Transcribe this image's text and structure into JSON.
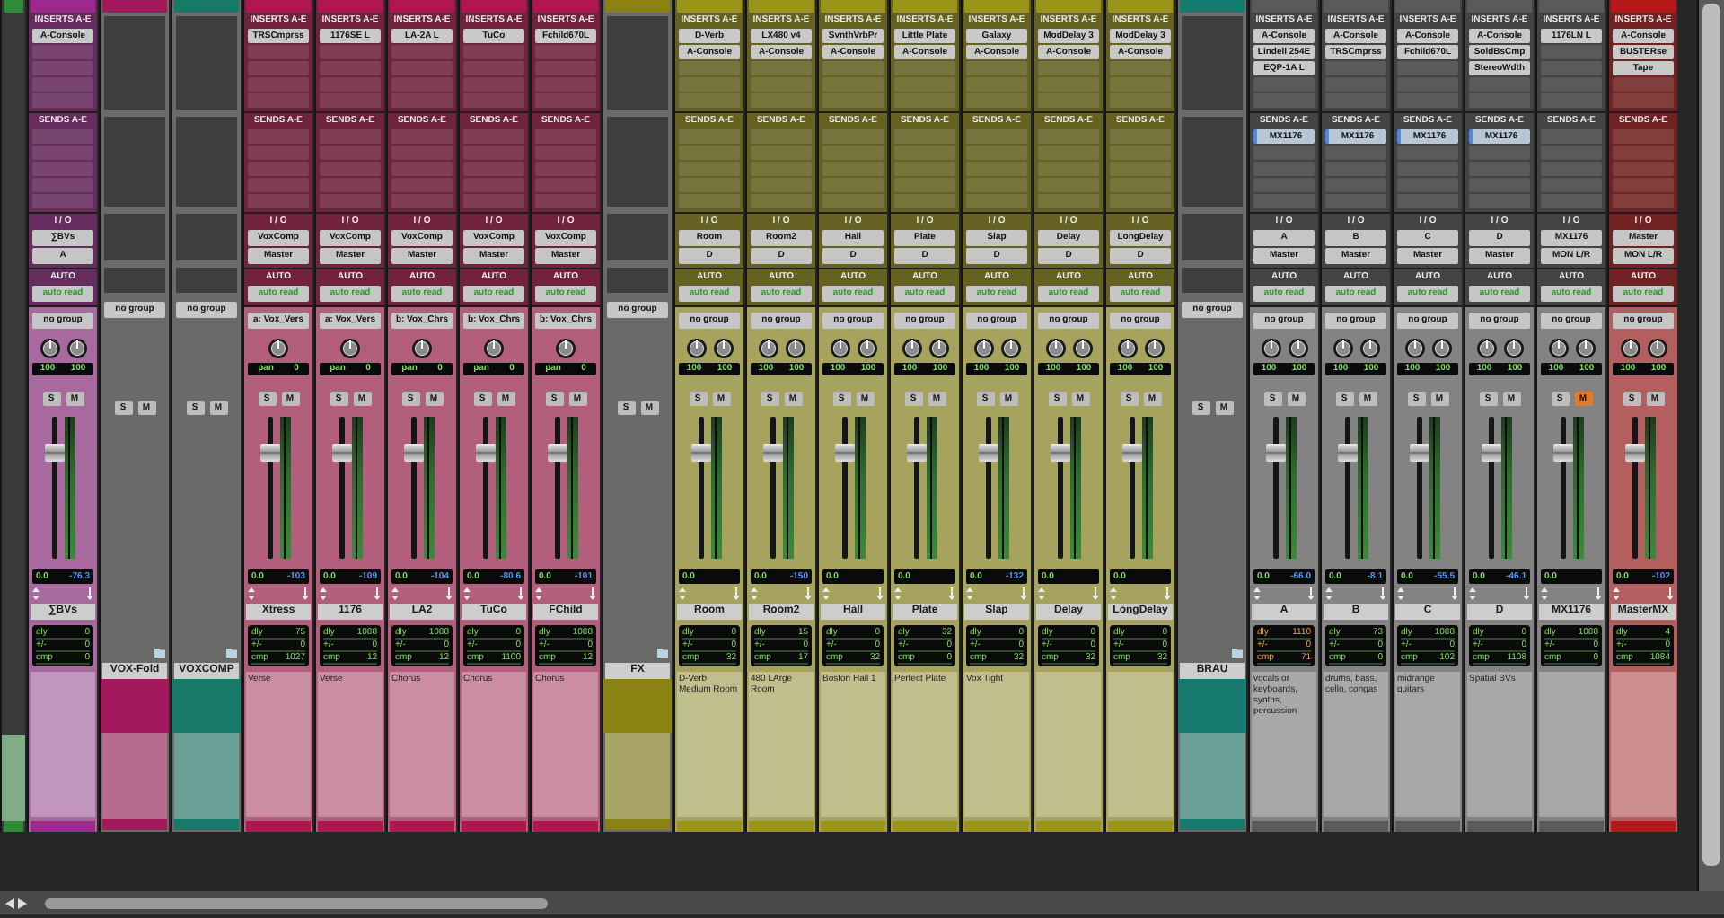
{
  "channels": [
    {
      "kind": "partial",
      "color": "#2f8a3a"
    },
    {
      "kind": "audio",
      "name": "∑BVs",
      "color": "#9c2a8c",
      "inserts_label": "INSERTS A-E",
      "inserts": [
        "A-Console"
      ],
      "sends_label": "SENDS A-E",
      "io_label": "I / O",
      "input": "∑BVs",
      "output": "A",
      "auto_label": "AUTO",
      "automation": "auto read",
      "group": "no group",
      "knobs": [
        "100",
        "100"
      ],
      "solo": {
        "label": "S",
        "on": false
      },
      "mute": {
        "label": "M",
        "on": false
      },
      "fader": {
        "level": 0.75
      },
      "volume": "0.0",
      "peak": "-76.3",
      "delay": [
        {
          "label": "dly",
          "value": "0"
        },
        {
          "label": "+/-",
          "value": "0"
        },
        {
          "label": "cmp",
          "value": "0"
        }
      ],
      "delay_warning": false
    },
    {
      "kind": "folder",
      "name": "VOX-Fold",
      "color": "#a3195b",
      "group": "no group",
      "solo": {
        "label": "S",
        "on": false
      },
      "mute": {
        "label": "M",
        "on": false
      }
    },
    {
      "kind": "folder",
      "name": "VOXCOMP",
      "color": "#177a68",
      "group": "no group",
      "solo": {
        "label": "S",
        "on": false
      },
      "mute": {
        "label": "M",
        "on": false
      }
    },
    {
      "kind": "aux",
      "name": "Xtress",
      "color": "#b0174f",
      "inserts_label": "INSERTS A-E",
      "inserts": [
        "TRSCmprss"
      ],
      "sends_label": "SENDS A-E",
      "io_label": "I / O",
      "input": "VoxComp",
      "output": "Master",
      "auto_label": "AUTO",
      "automation": "auto read",
      "group": "a: Vox_Vers",
      "pan": {
        "label": "pan",
        "value": "0"
      },
      "solo": {
        "label": "S",
        "on": false
      },
      "mute": {
        "label": "M",
        "on": false
      },
      "fader": {
        "level": 0.75
      },
      "volume": "0.0",
      "peak": "-103",
      "delay": [
        {
          "label": "dly",
          "value": "75"
        },
        {
          "label": "+/-",
          "value": "0"
        },
        {
          "label": "cmp",
          "value": "1027"
        }
      ],
      "delay_warning": false,
      "comment": "Verse"
    },
    {
      "kind": "aux",
      "name": "1176",
      "color": "#b0174f",
      "inserts_label": "INSERTS A-E",
      "inserts": [
        "1176SE L"
      ],
      "sends_label": "SENDS A-E",
      "io_label": "I / O",
      "input": "VoxComp",
      "output": "Master",
      "auto_label": "AUTO",
      "automation": "auto read",
      "group": "a: Vox_Vers",
      "pan": {
        "label": "pan",
        "value": "0"
      },
      "solo": {
        "label": "S",
        "on": false
      },
      "mute": {
        "label": "M",
        "on": false
      },
      "fader": {
        "level": 0.75
      },
      "volume": "0.0",
      "peak": "-109",
      "delay": [
        {
          "label": "dly",
          "value": "1088"
        },
        {
          "label": "+/-",
          "value": "0"
        },
        {
          "label": "cmp",
          "value": "12"
        }
      ],
      "delay_warning": false,
      "comment": "Verse"
    },
    {
      "kind": "aux",
      "name": "LA2",
      "color": "#b0174f",
      "inserts_label": "INSERTS A-E",
      "inserts": [
        "LA-2A L"
      ],
      "sends_label": "SENDS A-E",
      "io_label": "I / O",
      "input": "VoxComp",
      "output": "Master",
      "auto_label": "AUTO",
      "automation": "auto read",
      "group": "b: Vox_Chrs",
      "pan": {
        "label": "pan",
        "value": "0"
      },
      "solo": {
        "label": "S",
        "on": false
      },
      "mute": {
        "label": "M",
        "on": false
      },
      "fader": {
        "level": 0.75
      },
      "volume": "0.0",
      "peak": "-104",
      "delay": [
        {
          "label": "dly",
          "value": "1088"
        },
        {
          "label": "+/-",
          "value": "0"
        },
        {
          "label": "cmp",
          "value": "12"
        }
      ],
      "delay_warning": false,
      "comment": "Chorus"
    },
    {
      "kind": "aux",
      "name": "TuCo",
      "color": "#b0174f",
      "inserts_label": "INSERTS A-E",
      "inserts": [
        "TuCo"
      ],
      "sends_label": "SENDS A-E",
      "io_label": "I / O",
      "input": "VoxComp",
      "output": "Master",
      "auto_label": "AUTO",
      "automation": "auto read",
      "group": "b: Vox_Chrs",
      "pan": {
        "label": "pan",
        "value": "0"
      },
      "solo": {
        "label": "S",
        "on": false
      },
      "mute": {
        "label": "M",
        "on": false
      },
      "fader": {
        "level": 0.75
      },
      "volume": "0.0",
      "peak": "-80.6",
      "delay": [
        {
          "label": "dly",
          "value": "0"
        },
        {
          "label": "+/-",
          "value": "0"
        },
        {
          "label": "cmp",
          "value": "1100"
        }
      ],
      "delay_warning": false,
      "comment": "Chorus"
    },
    {
      "kind": "aux",
      "name": "FChild",
      "color": "#b0174f",
      "inserts_label": "INSERTS A-E",
      "inserts": [
        "Fchild670L"
      ],
      "sends_label": "SENDS A-E",
      "io_label": "I / O",
      "input": "VoxComp",
      "output": "Master",
      "auto_label": "AUTO",
      "automation": "auto read",
      "group": "b: Vox_Chrs",
      "pan": {
        "label": "pan",
        "value": "0"
      },
      "solo": {
        "label": "S",
        "on": false
      },
      "mute": {
        "label": "M",
        "on": false
      },
      "fader": {
        "level": 0.75
      },
      "volume": "0.0",
      "peak": "-101",
      "delay": [
        {
          "label": "dly",
          "value": "1088"
        },
        {
          "label": "+/-",
          "value": "0"
        },
        {
          "label": "cmp",
          "value": "12"
        }
      ],
      "delay_warning": false,
      "comment": "Chorus"
    },
    {
      "kind": "folder",
      "name": "FX",
      "color": "#8a8212",
      "group": "no group",
      "solo": {
        "label": "S",
        "on": false
      },
      "mute": {
        "label": "M",
        "on": false
      }
    },
    {
      "kind": "audio",
      "name": "Room",
      "color": "#9a9418",
      "inserts_label": "INSERTS A-E",
      "inserts": [
        "D-Verb",
        "A-Console"
      ],
      "sends_label": "SENDS A-E",
      "io_label": "I / O",
      "input": "Room",
      "output": "D",
      "auto_label": "AUTO",
      "automation": "auto read",
      "group": "no group",
      "knobs": [
        "100",
        "100"
      ],
      "solo": {
        "label": "S",
        "on": false
      },
      "mute": {
        "label": "M",
        "on": false
      },
      "fader": {
        "level": 0.75
      },
      "volume": "0.0",
      "delay": [
        {
          "label": "dly",
          "value": "0"
        },
        {
          "label": "+/-",
          "value": "0"
        },
        {
          "label": "cmp",
          "value": "32"
        }
      ],
      "delay_warning": false,
      "comment": "D-Verb Medium Room"
    },
    {
      "kind": "audio",
      "name": "Room2",
      "color": "#9a9418",
      "inserts_label": "INSERTS A-E",
      "inserts": [
        "LX480 v4",
        "A-Console"
      ],
      "sends_label": "SENDS A-E",
      "io_label": "I / O",
      "input": "Room2",
      "output": "D",
      "auto_label": "AUTO",
      "automation": "auto read",
      "group": "no group",
      "knobs": [
        "100",
        "100"
      ],
      "solo": {
        "label": "S",
        "on": false
      },
      "mute": {
        "label": "M",
        "on": false
      },
      "fader": {
        "level": 0.75
      },
      "volume": "0.0",
      "peak": "-150",
      "delay": [
        {
          "label": "dly",
          "value": "15"
        },
        {
          "label": "+/-",
          "value": "0"
        },
        {
          "label": "cmp",
          "value": "17"
        }
      ],
      "delay_warning": false,
      "comment": "480 LArge Room"
    },
    {
      "kind": "audio",
      "name": "Hall",
      "color": "#9a9418",
      "inserts_label": "INSERTS A-E",
      "inserts": [
        "SvnthVrbPr",
        "A-Console"
      ],
      "sends_label": "SENDS A-E",
      "io_label": "I / O",
      "input": "Hall",
      "output": "D",
      "auto_label": "AUTO",
      "automation": "auto read",
      "group": "no group",
      "knobs": [
        "100",
        "100"
      ],
      "solo": {
        "label": "S",
        "on": false
      },
      "mute": {
        "label": "M",
        "on": false
      },
      "fader": {
        "level": 0.75
      },
      "volume": "0.0",
      "delay": [
        {
          "label": "dly",
          "value": "0"
        },
        {
          "label": "+/-",
          "value": "0"
        },
        {
          "label": "cmp",
          "value": "32"
        }
      ],
      "delay_warning": false,
      "comment": "Boston Hall 1"
    },
    {
      "kind": "audio",
      "name": "Plate",
      "color": "#9a9418",
      "inserts_label": "INSERTS A-E",
      "inserts": [
        "Little Plate",
        "A-Console"
      ],
      "sends_label": "SENDS A-E",
      "io_label": "I / O",
      "input": "Plate",
      "output": "D",
      "auto_label": "AUTO",
      "automation": "auto read",
      "group": "no group",
      "knobs": [
        "100",
        "100"
      ],
      "solo": {
        "label": "S",
        "on": false
      },
      "mute": {
        "label": "M",
        "on": false
      },
      "fader": {
        "level": 0.75
      },
      "volume": "0.0",
      "delay": [
        {
          "label": "dly",
          "value": "32"
        },
        {
          "label": "+/-",
          "value": "0"
        },
        {
          "label": "cmp",
          "value": "0"
        }
      ],
      "delay_warning": false,
      "comment": "Perfect Plate"
    },
    {
      "kind": "audio",
      "name": "Slap",
      "color": "#9a9418",
      "inserts_label": "INSERTS A-E",
      "inserts": [
        "Galaxy",
        "A-Console"
      ],
      "sends_label": "SENDS A-E",
      "io_label": "I / O",
      "input": "Slap",
      "output": "D",
      "auto_label": "AUTO",
      "automation": "auto read",
      "group": "no group",
      "knobs": [
        "100",
        "100"
      ],
      "solo": {
        "label": "S",
        "on": false
      },
      "mute": {
        "label": "M",
        "on": false
      },
      "fader": {
        "level": 0.75
      },
      "volume": "0.0",
      "peak": "-132",
      "delay": [
        {
          "label": "dly",
          "value": "0"
        },
        {
          "label": "+/-",
          "value": "0"
        },
        {
          "label": "cmp",
          "value": "32"
        }
      ],
      "delay_warning": false,
      "comment": "Vox Tight"
    },
    {
      "kind": "audio",
      "name": "Delay",
      "color": "#9a9418",
      "inserts_label": "INSERTS A-E",
      "inserts": [
        "ModDelay 3",
        "A-Console"
      ],
      "sends_label": "SENDS A-E",
      "io_label": "I / O",
      "input": "Delay",
      "output": "D",
      "auto_label": "AUTO",
      "automation": "auto read",
      "group": "no group",
      "knobs": [
        "100",
        "100"
      ],
      "solo": {
        "label": "S",
        "on": false
      },
      "mute": {
        "label": "M",
        "on": false
      },
      "fader": {
        "level": 0.75
      },
      "volume": "0.0",
      "delay": [
        {
          "label": "dly",
          "value": "0"
        },
        {
          "label": "+/-",
          "value": "0"
        },
        {
          "label": "cmp",
          "value": "32"
        }
      ],
      "delay_warning": false
    },
    {
      "kind": "audio",
      "name": "LongDelay",
      "color": "#9a9418",
      "inserts_label": "INSERTS A-E",
      "inserts": [
        "ModDelay 3",
        "A-Console"
      ],
      "sends_label": "SENDS A-E",
      "io_label": "I / O",
      "input": "LongDelay",
      "output": "D",
      "auto_label": "AUTO",
      "automation": "auto read",
      "group": "no group",
      "knobs": [
        "100",
        "100"
      ],
      "solo": {
        "label": "S",
        "on": false
      },
      "mute": {
        "label": "M",
        "on": false
      },
      "fader": {
        "level": 0.75
      },
      "volume": "0.0",
      "delay": [
        {
          "label": "dly",
          "value": "0"
        },
        {
          "label": "+/-",
          "value": "0"
        },
        {
          "label": "cmp",
          "value": "32"
        }
      ],
      "delay_warning": false
    },
    {
      "kind": "folder",
      "name": "BRAU",
      "color": "#177a6e",
      "group": "no group",
      "solo": {
        "label": "S",
        "on": false
      },
      "mute": {
        "label": "M",
        "on": false
      }
    },
    {
      "kind": "audio",
      "name": "A",
      "color": "#5a5a5a",
      "inserts_label": "INSERTS A-E",
      "inserts": [
        "A-Console",
        "Lindell 254E",
        "EQP-1A L"
      ],
      "sends_label": "SENDS A-E",
      "sends": [
        "MX1176"
      ],
      "io_label": "I / O",
      "input": "A",
      "output": "Master",
      "auto_label": "AUTO",
      "automation": "auto read",
      "group": "no group",
      "knobs": [
        "100",
        "100"
      ],
      "solo": {
        "label": "S",
        "on": false
      },
      "mute": {
        "label": "M",
        "on": false
      },
      "fader": {
        "level": 0.75
      },
      "volume": "0.0",
      "peak": "-66.0",
      "delay": [
        {
          "label": "dly",
          "value": "1110"
        },
        {
          "label": "+/-",
          "value": "0"
        },
        {
          "label": "cmp",
          "value": "71"
        }
      ],
      "delay_warning": true,
      "comment": "vocals or keyboards, synths, percussion"
    },
    {
      "kind": "audio",
      "name": "B",
      "color": "#5a5a5a",
      "inserts_label": "INSERTS A-E",
      "inserts": [
        "A-Console",
        "TRSCmprss"
      ],
      "sends_label": "SENDS A-E",
      "sends": [
        "MX1176"
      ],
      "io_label": "I / O",
      "input": "B",
      "output": "Master",
      "auto_label": "AUTO",
      "automation": "auto read",
      "group": "no group",
      "knobs": [
        "100",
        "100"
      ],
      "solo": {
        "label": "S",
        "on": false
      },
      "mute": {
        "label": "M",
        "on": false
      },
      "fader": {
        "level": 0.75
      },
      "volume": "0.0",
      "peak": "-8.1",
      "delay": [
        {
          "label": "dly",
          "value": "73"
        },
        {
          "label": "+/-",
          "value": "0"
        },
        {
          "label": "cmp",
          "value": "0"
        }
      ],
      "delay_warning": false,
      "comment": "drums, bass, cello, congas"
    },
    {
      "kind": "audio",
      "name": "C",
      "color": "#5a5a5a",
      "inserts_label": "INSERTS A-E",
      "inserts": [
        "A-Console",
        "Fchild670L"
      ],
      "sends_label": "SENDS A-E",
      "sends": [
        "MX1176"
      ],
      "io_label": "I / O",
      "input": "C",
      "output": "Master",
      "auto_label": "AUTO",
      "automation": "auto read",
      "group": "no group",
      "knobs": [
        "100",
        "100"
      ],
      "solo": {
        "label": "S",
        "on": false
      },
      "mute": {
        "label": "M",
        "on": false
      },
      "fader": {
        "level": 0.75
      },
      "volume": "0.0",
      "peak": "-55.5",
      "delay": [
        {
          "label": "dly",
          "value": "1088"
        },
        {
          "label": "+/-",
          "value": "0"
        },
        {
          "label": "cmp",
          "value": "102"
        }
      ],
      "delay_warning": false,
      "comment": "midrange guitars"
    },
    {
      "kind": "audio",
      "name": "D",
      "color": "#5a5a5a",
      "inserts_label": "INSERTS A-E",
      "inserts": [
        "A-Console",
        "SoldBsCmp",
        "StereoWdth"
      ],
      "sends_label": "SENDS A-E",
      "sends": [
        "MX1176"
      ],
      "io_label": "I / O",
      "input": "D",
      "output": "Master",
      "auto_label": "AUTO",
      "automation": "auto read",
      "group": "no group",
      "knobs": [
        "100",
        "100"
      ],
      "solo": {
        "label": "S",
        "on": false
      },
      "mute": {
        "label": "M",
        "on": false
      },
      "fader": {
        "level": 0.75
      },
      "volume": "0.0",
      "peak": "-46.1",
      "delay": [
        {
          "label": "dly",
          "value": "0"
        },
        {
          "label": "+/-",
          "value": "0"
        },
        {
          "label": "cmp",
          "value": "1108"
        }
      ],
      "delay_warning": false,
      "comment": "Spatial BVs"
    },
    {
      "kind": "audio",
      "name": "MX1176",
      "color": "#5a5a5a",
      "inserts_label": "INSERTS A-E",
      "inserts": [
        "1176LN L"
      ],
      "sends_label": "SENDS A-E",
      "io_label": "I / O",
      "input": "MX1176",
      "output": "MON L/R",
      "auto_label": "AUTO",
      "automation": "auto read",
      "group": "no group",
      "knobs": [
        "100",
        "100"
      ],
      "solo": {
        "label": "S",
        "on": false
      },
      "mute": {
        "label": "M",
        "on": true
      },
      "fader": {
        "level": 0.75
      },
      "volume": "0.0",
      "delay": [
        {
          "label": "dly",
          "value": "1088"
        },
        {
          "label": "+/-",
          "value": "0"
        },
        {
          "label": "cmp",
          "value": "0"
        }
      ],
      "delay_warning": false
    },
    {
      "kind": "audio",
      "name": "MasterMX",
      "color": "#b41818",
      "inserts_label": "INSERTS A-E",
      "inserts": [
        "A-Console",
        "BUSTERse",
        "Tape"
      ],
      "sends_label": "SENDS A-E",
      "io_label": "I / O",
      "input": "Master",
      "output": "MON L/R",
      "auto_label": "AUTO",
      "automation": "auto read",
      "group": "no group",
      "knobs": [
        "100",
        "100"
      ],
      "solo": {
        "label": "S",
        "on": false
      },
      "mute": {
        "label": "M",
        "on": false
      },
      "fader": {
        "level": 0.75
      },
      "volume": "0.0",
      "peak": "-102",
      "delay": [
        {
          "label": "dly",
          "value": "4"
        },
        {
          "label": "+/-",
          "value": "0"
        },
        {
          "label": "cmp",
          "value": "1084"
        }
      ],
      "delay_warning": false
    }
  ]
}
